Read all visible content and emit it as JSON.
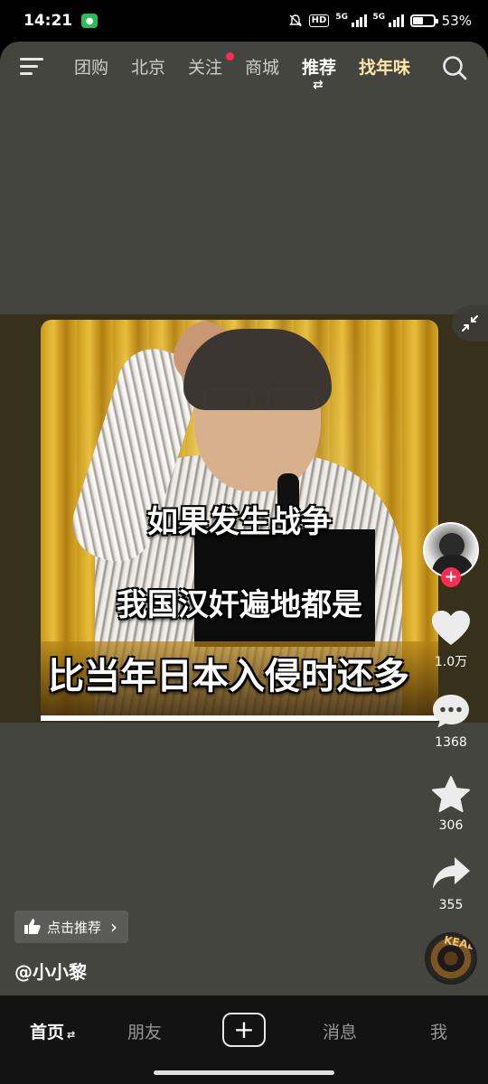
{
  "status_bar": {
    "time": "14:21",
    "wechat_icon": "wechat-icon",
    "hd_label": "HD",
    "network1": "5G",
    "network2": "5G",
    "battery_percent": "53%",
    "battery_level": 0.53
  },
  "top_nav": {
    "tabs": [
      {
        "label": "团购"
      },
      {
        "label": "北京"
      },
      {
        "label": "关注"
      },
      {
        "label": "商城"
      },
      {
        "label": "推荐"
      },
      {
        "label": "找年味"
      }
    ],
    "active_tab": "推荐",
    "swap_symbol": "⇄"
  },
  "video": {
    "captions": [
      "如果发生战争",
      "我国汉奸遍地都是",
      "比当年日本入侵时还多"
    ]
  },
  "rail": {
    "follow_symbol": "+",
    "likes": "1.0万",
    "comments": "1368",
    "favorites": "306",
    "shares": "355"
  },
  "music_disc_text": "KEAD",
  "recommend_chip": {
    "label": "点击推荐",
    "chevron": "›"
  },
  "author": "@小小黎",
  "tabbar": {
    "home": "首页",
    "home_swap": "⇄",
    "friends": "朋友",
    "plus": "+",
    "messages": "消息",
    "me": "我"
  },
  "colors": {
    "accent_red": "#fe2c55",
    "special_tab": "#ffe7a8",
    "app_bg": "#454540"
  }
}
